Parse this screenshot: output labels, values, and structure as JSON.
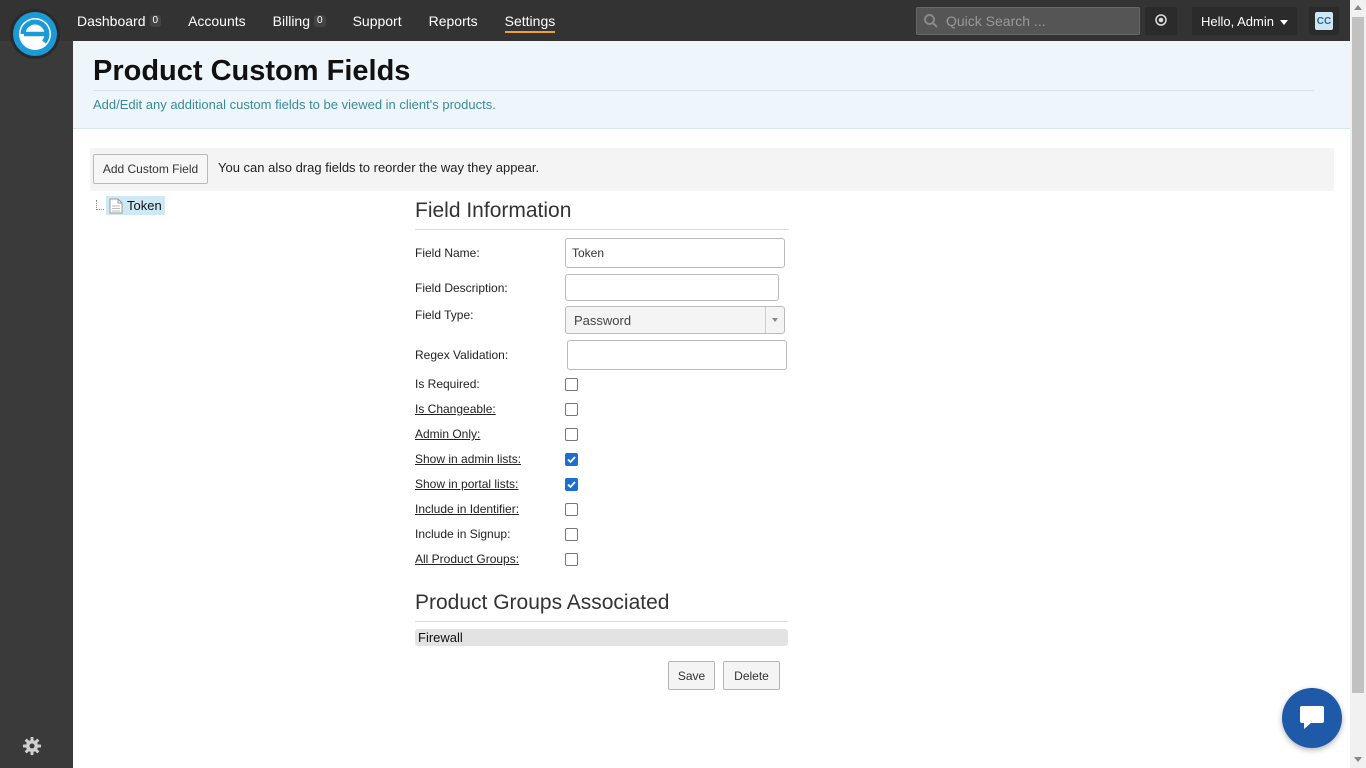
{
  "nav": {
    "items": [
      {
        "label": "Dashboard",
        "badge": "0"
      },
      {
        "label": "Accounts"
      },
      {
        "label": "Billing",
        "badge": "0"
      },
      {
        "label": "Support"
      },
      {
        "label": "Reports"
      },
      {
        "label": "Settings"
      }
    ]
  },
  "search": {
    "placeholder": "Quick Search ..."
  },
  "user": {
    "greeting": "Hello, Admin"
  },
  "cc": {
    "label": "CC"
  },
  "page": {
    "title": "Product Custom Fields",
    "subtitle": "Add/Edit any additional custom fields to be viewed in client's products."
  },
  "toolbar": {
    "add_label": "Add Custom Field",
    "note": "You can also drag fields to reorder the way they appear."
  },
  "tree": {
    "node_label": "Token"
  },
  "field_info": {
    "title": "Field Information",
    "field_name_label": "Field Name:",
    "field_name_value": "Token",
    "description_label": "Field Description:",
    "type_label": "Field Type:",
    "type_value": "Password",
    "regex_label": "Regex Validation:",
    "regex_value": "",
    "checkboxes": [
      {
        "label": "Is Required:",
        "checked": false
      },
      {
        "label": "Is Changeable:",
        "checked": false
      },
      {
        "label": "Admin Only:",
        "checked": false
      },
      {
        "label": "Show in admin lists:",
        "checked": true
      },
      {
        "label": "Show in portal lists:",
        "checked": true
      },
      {
        "label": "Include in Identifier:",
        "checked": false
      },
      {
        "label": "Include in Signup:",
        "checked": false
      },
      {
        "label": "All Product Groups:",
        "checked": false
      }
    ]
  },
  "groups": {
    "title": "Product Groups Associated",
    "items": [
      "Firewall"
    ]
  },
  "actions": {
    "save_label": "Save",
    "delete_label": "Delete"
  },
  "colors": {
    "accent": "#f0a030",
    "topbar": "#333333",
    "checkbox": "#1a6fd0",
    "chat": "#1e5aa8"
  }
}
